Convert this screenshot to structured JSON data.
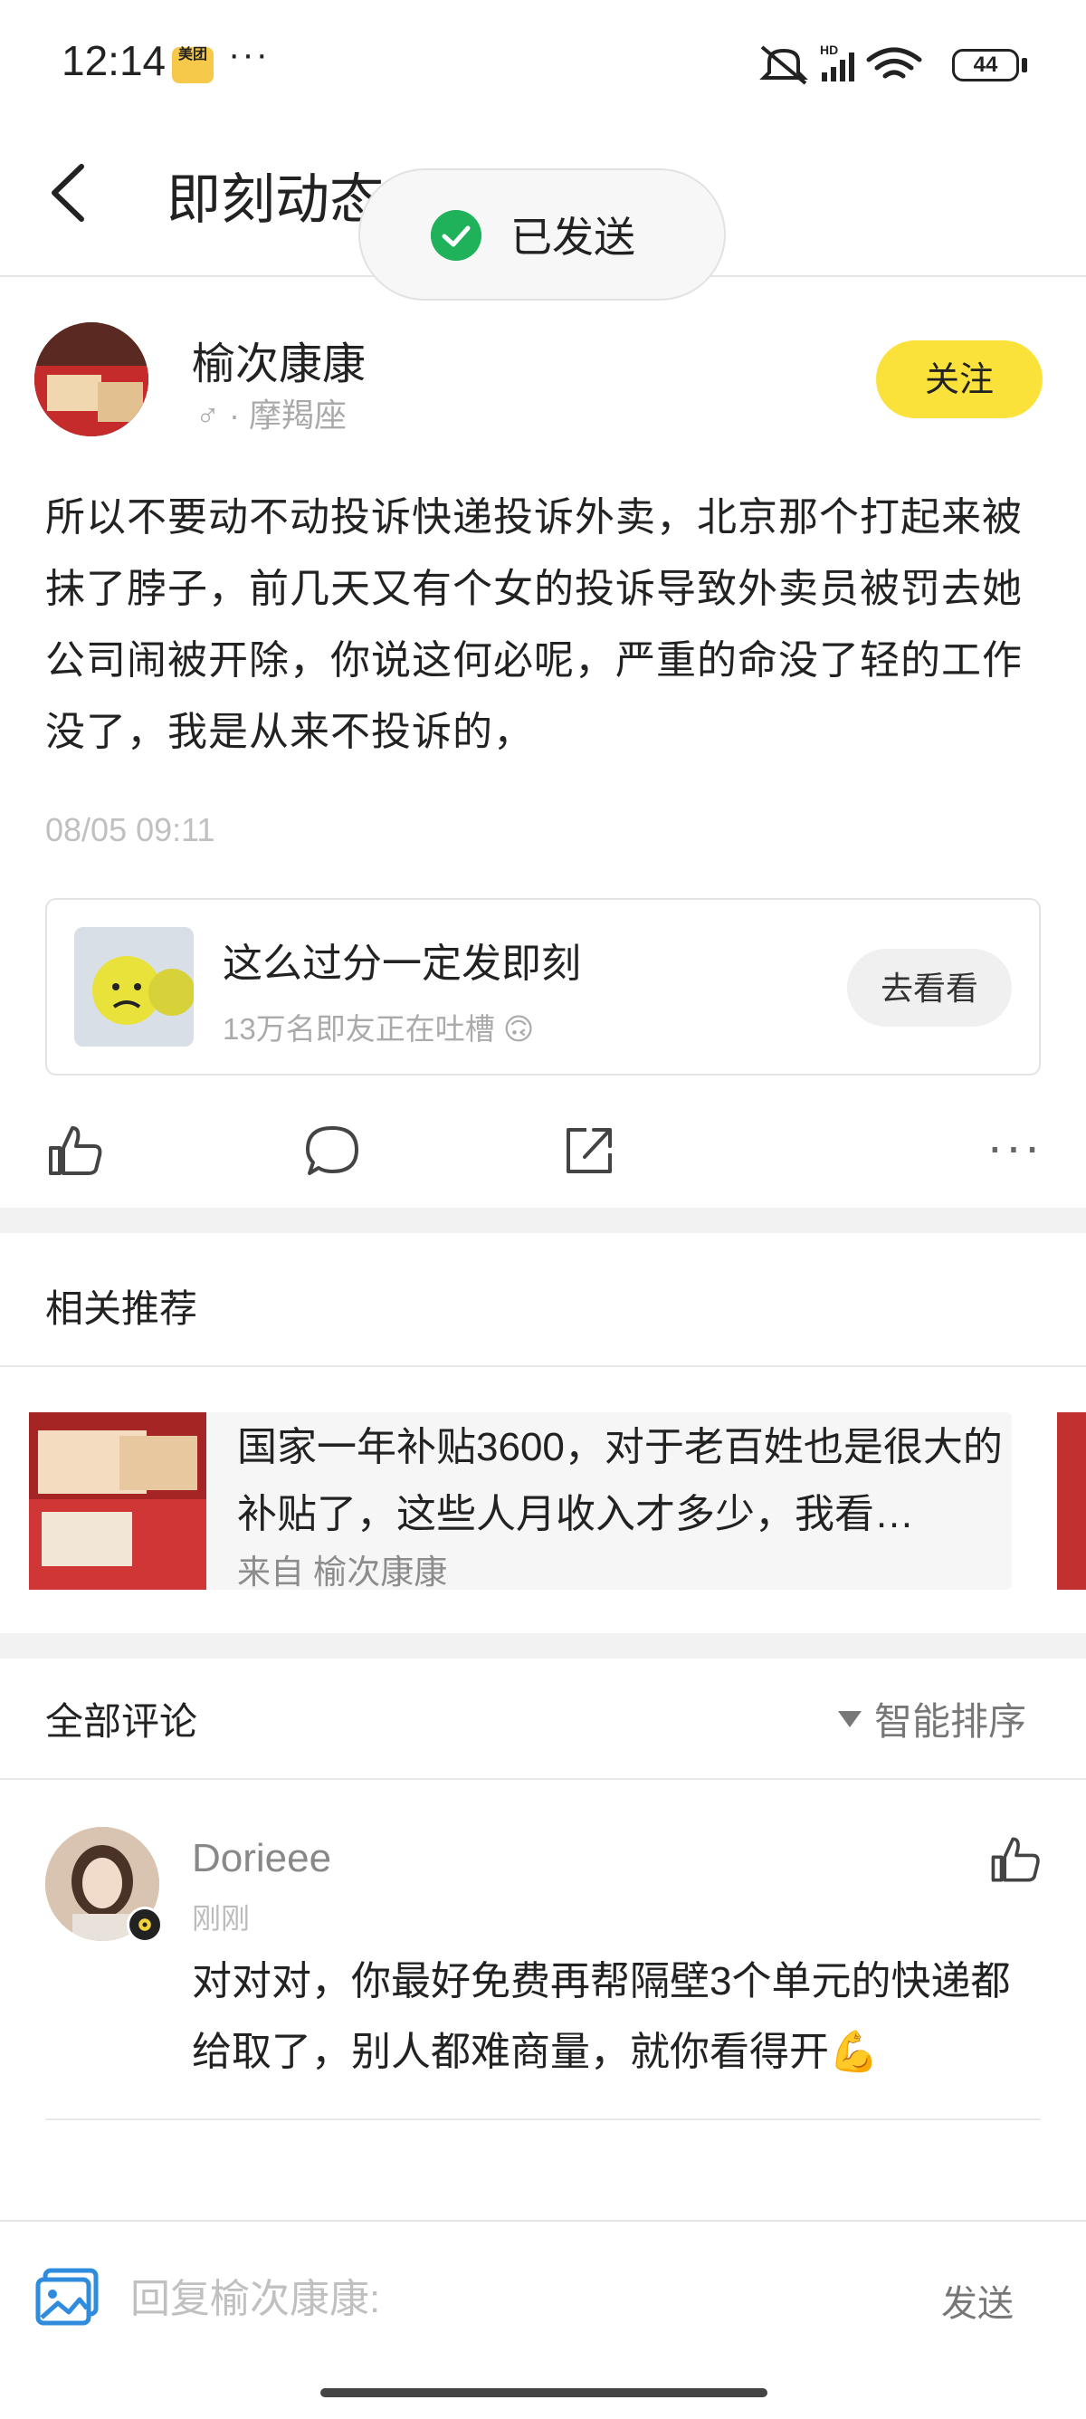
{
  "status_bar": {
    "time": "12:14",
    "app_badge": "美团",
    "more": "···",
    "battery": "44"
  },
  "header": {
    "title": "即刻动态",
    "toast": "已发送"
  },
  "post": {
    "author": "榆次康康",
    "author_meta": "♂ · 摩羯座",
    "follow_label": "关注",
    "text": "所以不要动不动投诉快递投诉外卖，北京那个打起来被抹了脖子，前几天又有个女的投诉导致外卖员被罚去她公司闹被开除，你说这何必呢，严重的命没了轻的工作没了，我是从来不投诉的，",
    "date": "08/05 09:11"
  },
  "promo": {
    "title": "这么过分一定发即刻",
    "subtitle": "13万名即友正在吐槽 🙃",
    "button": "去看看"
  },
  "actions": {
    "more": "···"
  },
  "related": {
    "title": "相关推荐",
    "item": {
      "text": "国家一年补贴3600，对于老百姓也是很大的补贴了，这些人月收入才多少，我看…",
      "source": "来自 榆次康康"
    }
  },
  "comments": {
    "title": "全部评论",
    "sort": "智能排序",
    "items": [
      {
        "name": "Dorieee",
        "time": "刚刚",
        "text": "对对对，你最好免费再帮隔壁3个单元的快递都给取了，别人都难商量，就你看得开💪"
      }
    ]
  },
  "reply": {
    "placeholder": "回复榆次康康:",
    "send": "发送"
  },
  "colors": {
    "accent_yellow": "#fbe23b",
    "success_green": "#1fb25a",
    "link_blue": "#2e8bde"
  }
}
